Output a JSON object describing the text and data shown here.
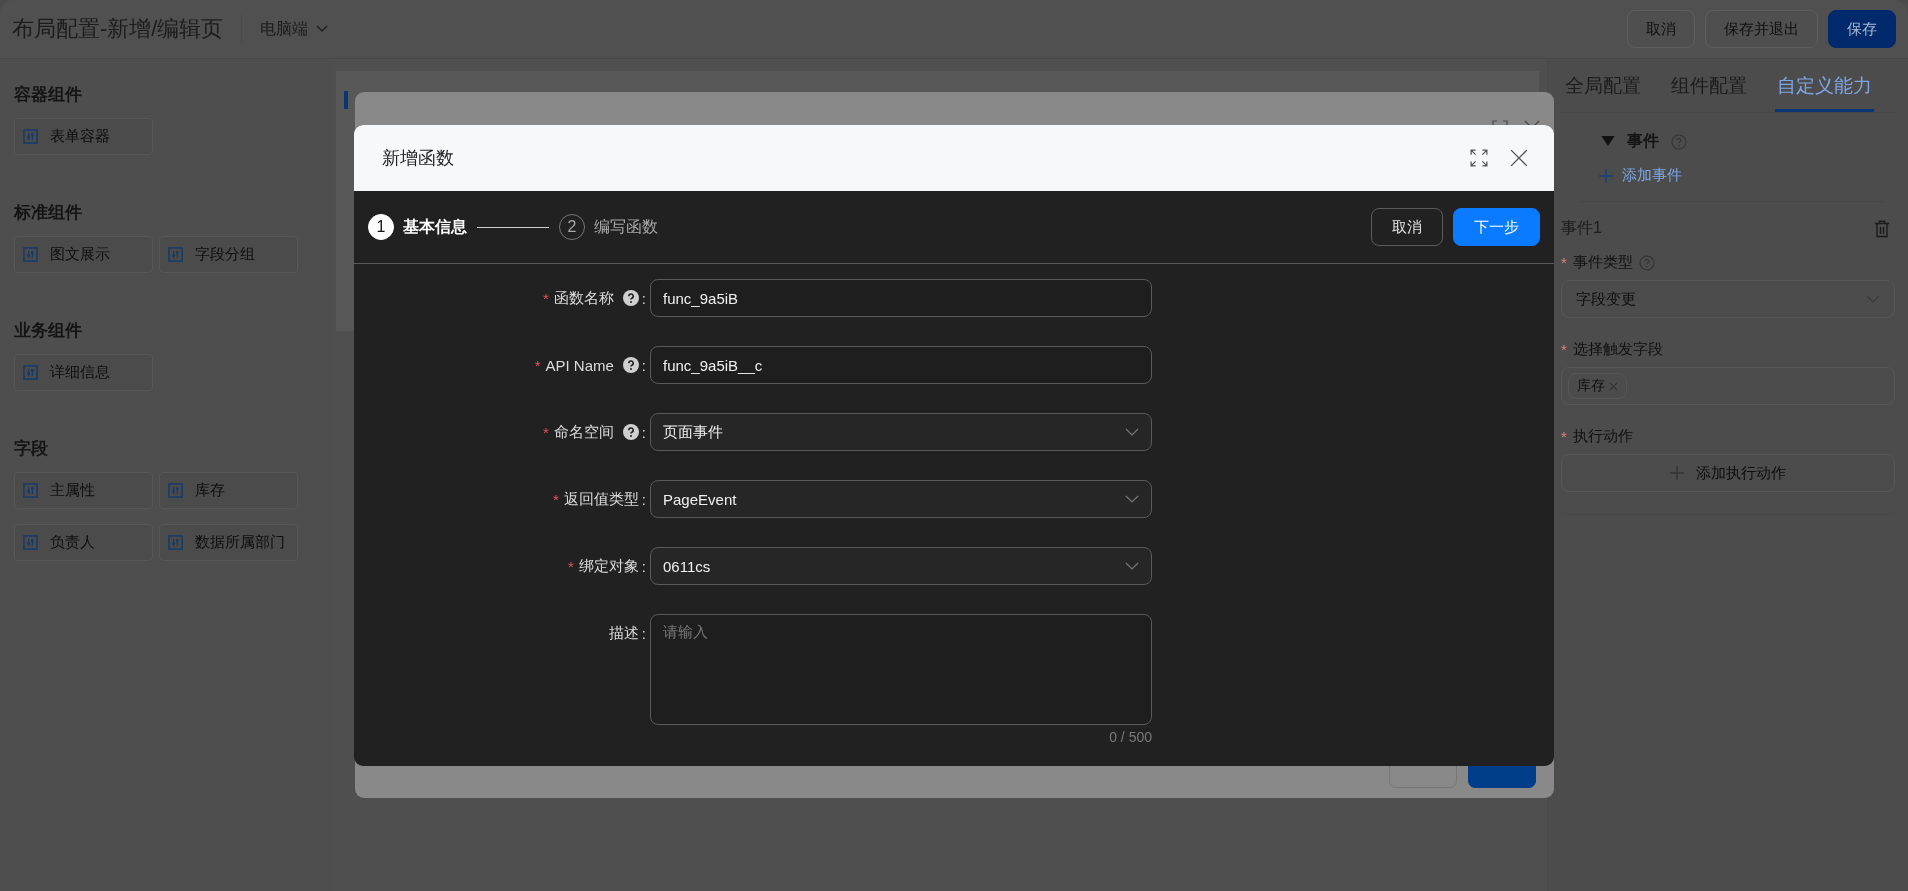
{
  "header": {
    "title": "布局配置-新增/编辑页",
    "device": "电脑端",
    "buttons": [
      {
        "label": "取消",
        "kind": "default"
      },
      {
        "label": "保存并退出",
        "kind": "default"
      },
      {
        "label": "保存",
        "kind": "primary"
      }
    ]
  },
  "sidebar": {
    "groups": [
      {
        "title": "容器组件",
        "items": [
          "表单容器"
        ]
      },
      {
        "title": "标准组件",
        "items": [
          "图文展示",
          "字段分组"
        ]
      },
      {
        "title": "业务组件",
        "items": [
          "详细信息"
        ]
      },
      {
        "title": "字段",
        "items": [
          "主属性",
          "库存",
          "负责人",
          "数据所属部门"
        ]
      }
    ]
  },
  "right_panel": {
    "tabs": [
      {
        "label": "全局配置",
        "selected": false
      },
      {
        "label": "组件配置",
        "selected": false
      },
      {
        "label": "自定义能力",
        "selected": true
      }
    ],
    "events": {
      "title": "事件",
      "expanded": true,
      "add_label": "添加事件"
    },
    "event": {
      "title": "事件1",
      "fields": [
        {
          "kind": "select",
          "label": "事件类型",
          "required_mark": "*",
          "help": true,
          "value": "字段变更"
        },
        {
          "kind": "tags",
          "label": "选择触发字段",
          "required_mark": "*",
          "tags": [
            "库存"
          ]
        },
        {
          "kind": "add",
          "label": "执行动作",
          "required_mark": "*",
          "button": "添加执行动作"
        }
      ]
    }
  },
  "dialog": {
    "title": "新增函数",
    "steps": [
      {
        "number": "1",
        "label": "基本信息",
        "selected": true
      },
      {
        "number": "2",
        "label": "编写函数",
        "selected": false
      }
    ],
    "buttons": [
      {
        "label": "取消",
        "kind": "default"
      },
      {
        "label": "下一步",
        "kind": "primary"
      }
    ],
    "fields": [
      {
        "kind": "input",
        "label": "函数名称",
        "required_mark": "*",
        "help": true,
        "colon": ":",
        "value": "func_9a5iB"
      },
      {
        "kind": "input",
        "label": "API Name",
        "required_mark": "*",
        "help": true,
        "colon": ":",
        "value": "func_9a5iB__c"
      },
      {
        "kind": "select",
        "label": "命名空间",
        "required_mark": "*",
        "help": true,
        "colon": ":",
        "value": "页面事件"
      },
      {
        "kind": "select",
        "label": "返回值类型",
        "required_mark": "*",
        "colon": ":",
        "value": "PageEvent"
      },
      {
        "kind": "select",
        "label": "绑定对象",
        "required_mark": "*",
        "colon": ":",
        "value": "0611cs"
      },
      {
        "kind": "textarea",
        "label": "描述",
        "colon": ":",
        "placeholder": "请输入",
        "counter": "0 / 500"
      }
    ]
  }
}
